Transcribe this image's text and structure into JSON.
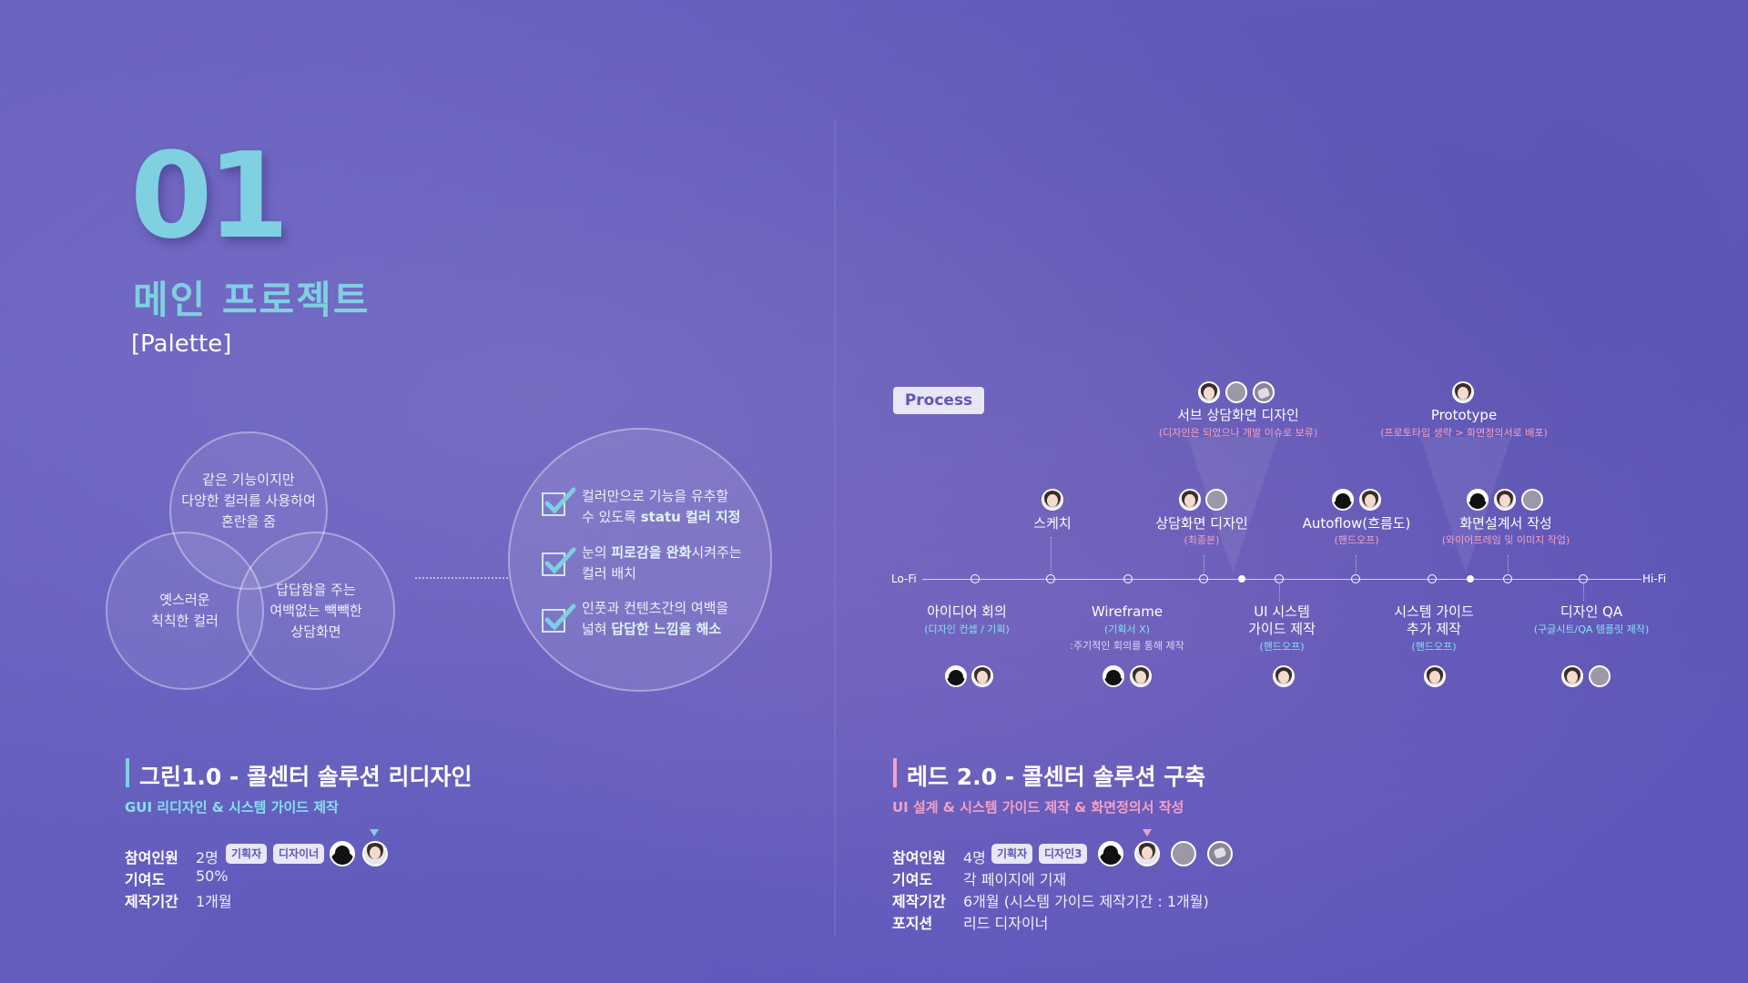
{
  "header": {
    "number": "01",
    "title": "메인 프로젝트",
    "subtitle": "[Palette]"
  },
  "venn": {
    "top": "같은 기능이지만\n다양한 컬러를 사용하여\n혼란을 줌",
    "left": "옛스러운\n칙칙한 컬러",
    "right": "답답함을 주는\n여백없는 빽빽한\n상담화면"
  },
  "solutions": [
    {
      "pre": "컬러만으로 기능을 유추할\n수 있도록 ",
      "bold": "statu 컬러 지정",
      "post": ""
    },
    {
      "pre": "눈의 ",
      "bold": "피로감을 완화",
      "post": "시켜주는\n컬러 배치"
    },
    {
      "pre": "인풋과 컨텐츠간의 여백을\n넓혀 ",
      "bold": "답답한 느낌을 해소",
      "post": ""
    }
  ],
  "project_left": {
    "title": "그린1.0 - 콜센터 솔루션 리디자인",
    "subtitle": "GUI 리디자인 & 시스템 가이드 제작",
    "rows": [
      {
        "label": "참여인원",
        "value": "2명"
      },
      {
        "label": "기여도",
        "value": "50%"
      },
      {
        "label": "제작기간",
        "value": "1개월"
      }
    ],
    "tags": [
      "기획자",
      "디자이너"
    ],
    "accent": "#7fd0e0"
  },
  "project_right": {
    "title": "레드 2.0 - 콜센터 솔루션 구축",
    "subtitle": "UI 설계 & 시스템 가이드 제작 & 화면정의서 작성",
    "rows": [
      {
        "label": "참여인원",
        "value": "4명"
      },
      {
        "label": "기여도",
        "value": "각 페이지에 기재"
      },
      {
        "label": "제작기간",
        "value": "6개월 (시스템 가이드 제작기간 : 1개월)"
      },
      {
        "label": "포지션",
        "value": "리드 디자이너"
      }
    ],
    "tags": [
      "기획자",
      "디자인3"
    ],
    "accent": "#f2a1c6"
  },
  "process": {
    "badge": "Process",
    "start": "Lo-Fi",
    "end": "Hi-Fi",
    "below": [
      {
        "label": "아이디어 회의",
        "sub": "(디자인 컨셉 / 기획)",
        "note": ""
      },
      {
        "label": "Wireframe",
        "sub": "(기획서 X)",
        "note": ":주기적인 회의를 통해 제작"
      },
      {
        "label": "UI 시스템\n가이드 제작",
        "sub": "(핸드오프)",
        "note": ""
      },
      {
        "label": "시스템 가이드\n추가 제작",
        "sub": "(핸드오프)",
        "note": ""
      },
      {
        "label": "디자인 QA",
        "sub": "(구글시트/QA 템플릿 제작)",
        "note": ""
      }
    ],
    "above": [
      {
        "label": "스케치",
        "sub": ""
      },
      {
        "label": "상담화면 디자인",
        "sub": "(최종본)"
      },
      {
        "label": "Autoflow(흐름도)",
        "sub": "(핸드오프)"
      },
      {
        "label": "화면설계서 작성",
        "sub": "(와이어프레임 및 이미지 작업)"
      }
    ],
    "top": [
      {
        "label": "서브 상담화면 디자인",
        "sub": "(디자인은 되었으나 개발 이슈로 보류)"
      },
      {
        "label": "Prototype",
        "sub": "(프로토타입 생략 > 화면정의서로 배포)"
      }
    ]
  }
}
